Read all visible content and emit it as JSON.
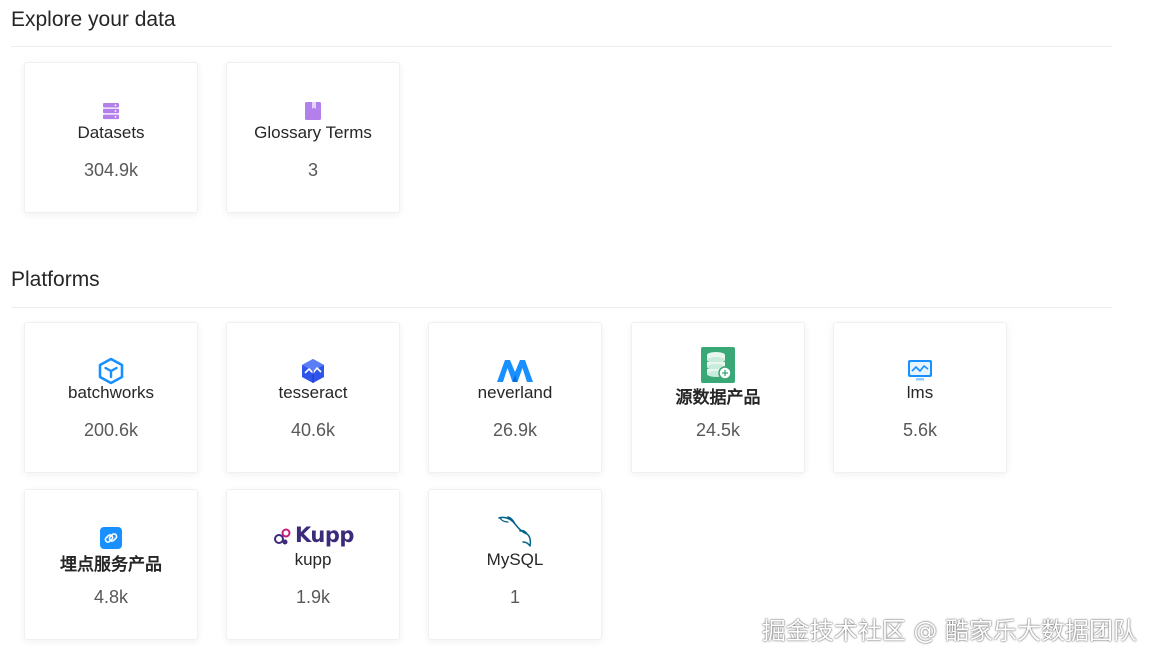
{
  "explore": {
    "title": "Explore your data",
    "cards": [
      {
        "label": "Datasets",
        "count": "304.9k",
        "icon": "dataset-stack-icon"
      },
      {
        "label": "Glossary Terms",
        "count": "3",
        "icon": "bookmark-icon"
      }
    ]
  },
  "platforms": {
    "title": "Platforms",
    "cards": [
      {
        "label": "batchworks",
        "count": "200.6k",
        "icon": "cube-icon"
      },
      {
        "label": "tesseract",
        "count": "40.6k",
        "icon": "tesseract-logo-icon"
      },
      {
        "label": "neverland",
        "count": "26.9k",
        "icon": "neverland-logo-icon"
      },
      {
        "label": "源数据产品",
        "count": "24.5k",
        "icon": "database-icon"
      },
      {
        "label": "lms",
        "count": "5.6k",
        "icon": "monitor-chart-icon"
      },
      {
        "label": "埋点服务产品",
        "count": "4.8k",
        "icon": "link-icon"
      },
      {
        "label": "kupp",
        "count": "1.9k",
        "icon": "kupp-logo-icon",
        "logo_text": "Kupp"
      },
      {
        "label": "MySQL",
        "count": "1",
        "icon": "mysql-dolphin-icon"
      }
    ]
  },
  "watermark": "掘金技术社区 @ 酷家乐大数据团队",
  "colors": {
    "purple": "#b37feb",
    "blue": "#1890ff",
    "kupp": "#3b2b7a",
    "db_green": "#3aa776"
  }
}
